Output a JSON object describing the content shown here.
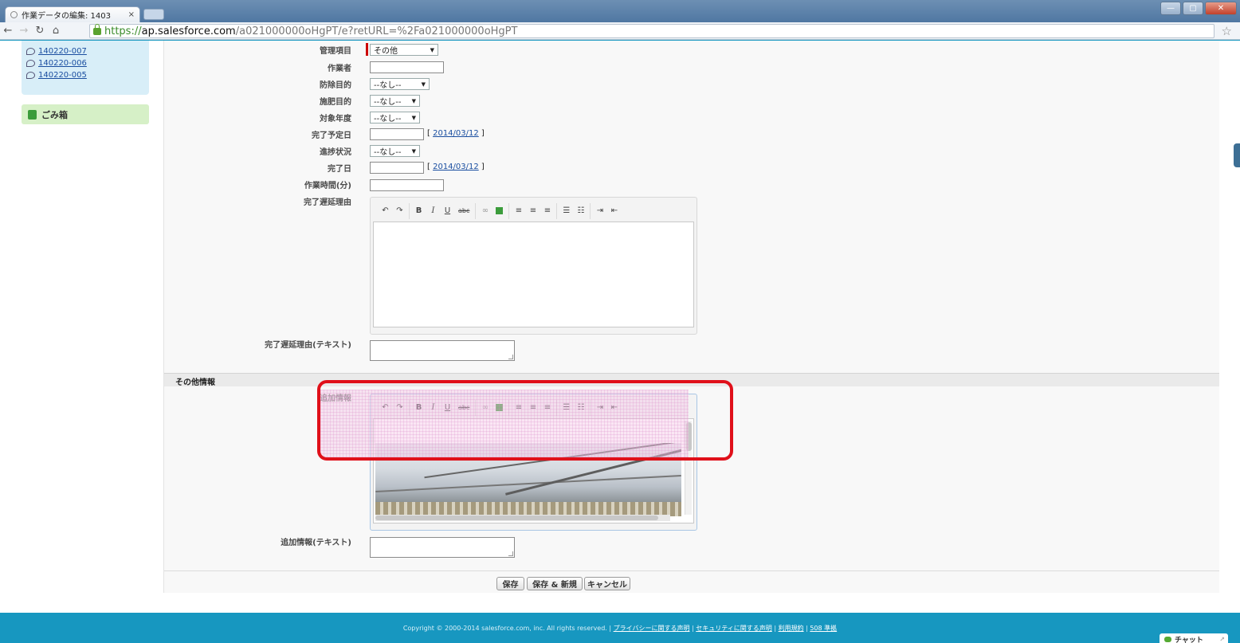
{
  "browser": {
    "tab_title": "作業データの編集: 1403",
    "tab_close": "×",
    "url_https": "https://",
    "url_host": "ap.salesforce.com",
    "url_path": "/a021000000oHgPT/e?retURL=%2Fa021000000oHgPT"
  },
  "sidebar": {
    "recent_items": [
      "140220-007",
      "140220-006",
      "140220-005"
    ],
    "trash_label": "ごみ箱"
  },
  "form": {
    "fields": {
      "kanri_label": "管理項目",
      "kanri_value": "その他",
      "worker_label": "作業者",
      "boujo_label": "防除目的",
      "boujo_value": "--なし--",
      "sehi_label": "施肥目的",
      "sehi_value": "--なし--",
      "nendo_label": "対象年度",
      "nendo_value": "--なし--",
      "yotei_label": "完了予定日",
      "yotei_link": "2014/03/12",
      "shinchoku_label": "進捗状況",
      "shinchoku_value": "--なし--",
      "kanryo_label": "完了日",
      "kanryo_link": "2014/03/12",
      "jikan_label": "作業時間(分)",
      "delay_label": "完了遅延理由",
      "delay_text_label": "完了遅延理由(テキスト)"
    },
    "section_other": "その他情報",
    "tsuika_label": "追加情報",
    "tsuika_text_label": "追加情報(テキスト)",
    "rte_toolbar": {
      "bold": "B",
      "italic": "I",
      "underline": "U",
      "strike": "abc"
    },
    "buttons": {
      "save": "保存",
      "save_new": "保存 & 新規",
      "cancel": "キャンセル"
    }
  },
  "footer": {
    "copyright": "Copyright © 2000-2014 salesforce.com, inc. All rights reserved. |",
    "links": [
      "プライバシーに関する声明",
      "セキュリティに関する声明",
      "利用規約",
      "508 準拠"
    ],
    "chat_label": "チャット"
  },
  "colors": {
    "brand_blue": "#1797c0",
    "highlight_red": "#e0101a",
    "required_red": "#cc0000"
  }
}
